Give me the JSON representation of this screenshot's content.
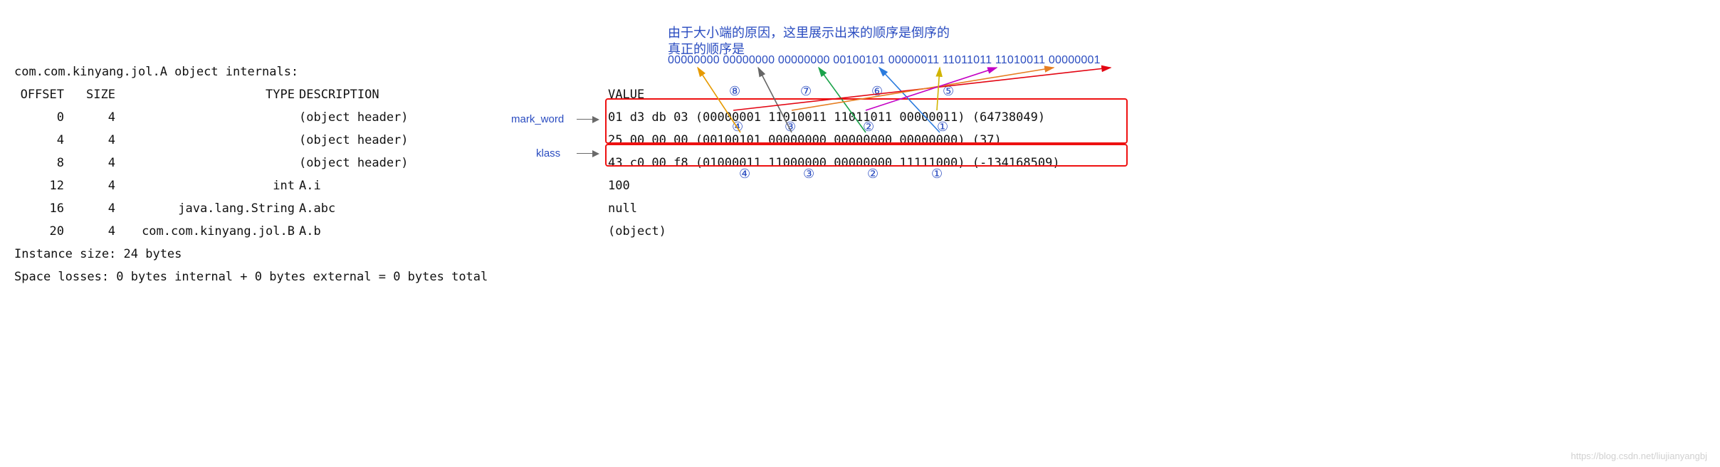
{
  "title": "com.com.kinyang.jol.A object internals:",
  "header": {
    "offset": "OFFSET",
    "size": "SIZE",
    "type": "TYPE",
    "desc": "DESCRIPTION",
    "value": "VALUE"
  },
  "rows": [
    {
      "offset": "0",
      "size": "4",
      "type": "",
      "desc": "(object header)",
      "value": "01 d3 db 03 (00000001 11010011 11011011 00000011) (64738049)"
    },
    {
      "offset": "4",
      "size": "4",
      "type": "",
      "desc": "(object header)",
      "value": "25 00 00 00 (00100101 00000000 00000000 00000000) (37)"
    },
    {
      "offset": "8",
      "size": "4",
      "type": "",
      "desc": "(object header)",
      "value": "43 c0 00 f8 (01000011 11000000 00000000 11111000) (-134168509)"
    },
    {
      "offset": "12",
      "size": "4",
      "type": "int",
      "desc": "A.i",
      "value": "100"
    },
    {
      "offset": "16",
      "size": "4",
      "type": "java.lang.String",
      "desc": "A.abc",
      "value": "null"
    },
    {
      "offset": "20",
      "size": "4",
      "type": "com.com.kinyang.jol.B",
      "desc": "A.b",
      "value": "(object)"
    }
  ],
  "footer1": "Instance size: 24 bytes",
  "footer2": "Space losses: 0 bytes internal + 0 bytes external = 0 bytes total",
  "labels": {
    "mark_word": "mark_word",
    "klass": "klass"
  },
  "note1": "由于大小端的原因，这里展示出来的顺序是倒序的",
  "note2": "真正的顺序是",
  "trueOrder": "00000000 00000000 00000000 00100101 00000011 11011011 11010011 00000001",
  "seqTop": {
    "s8": "⑧",
    "s7": "⑦",
    "s6": "⑥",
    "s5": "⑤"
  },
  "seqMid": {
    "s4": "④",
    "s3": "③",
    "s2": "②",
    "s1": "①"
  },
  "seqBot": {
    "s4": "④",
    "s3": "③",
    "s2": "②",
    "s1": "①"
  },
  "watermark": "https://blog.csdn.net/liujianyangbj"
}
